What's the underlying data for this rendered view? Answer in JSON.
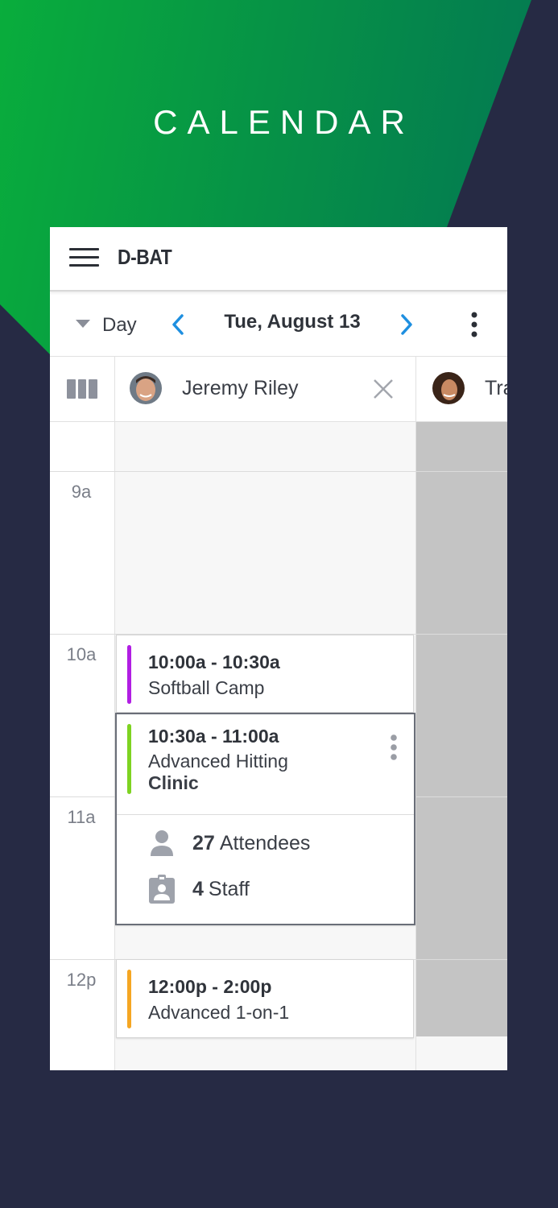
{
  "hero": {
    "title": "CALENDAR"
  },
  "colors": {
    "green_start": "#09ad3c",
    "green_end": "#056b54",
    "navy": "#262a44",
    "accent_blue": "#1e8fe0",
    "purple": "#b11ee3",
    "lime": "#7ed321",
    "orange": "#f5a623"
  },
  "topbar": {
    "brand": "D-BAT",
    "menu_icon": "hamburger-menu-icon"
  },
  "datebar": {
    "view_label": "Day",
    "date_label": "Tue, August 13",
    "prev_icon": "chevron-left-icon",
    "next_icon": "chevron-right-icon",
    "more_icon": "more-vertical-icon"
  },
  "staff": {
    "columns_icon": "columns-icon",
    "members": [
      {
        "name": "Jeremy Riley"
      },
      {
        "name": "Tra"
      }
    ]
  },
  "hours": [
    "9a",
    "10a",
    "11a",
    "12p"
  ],
  "events": [
    {
      "time": "10:00a - 10:30a",
      "title": "Softball Camp"
    },
    {
      "time": "10:30a - 11:00a",
      "title_line1": "Advanced Hitting",
      "title_line2": "Clinic",
      "attendees_count": "27",
      "attendees_label": "Attendees",
      "staff_count": "4",
      "staff_label": "Staff"
    },
    {
      "time": "12:00p - 2:00p",
      "title": "Advanced 1-on-1"
    }
  ]
}
